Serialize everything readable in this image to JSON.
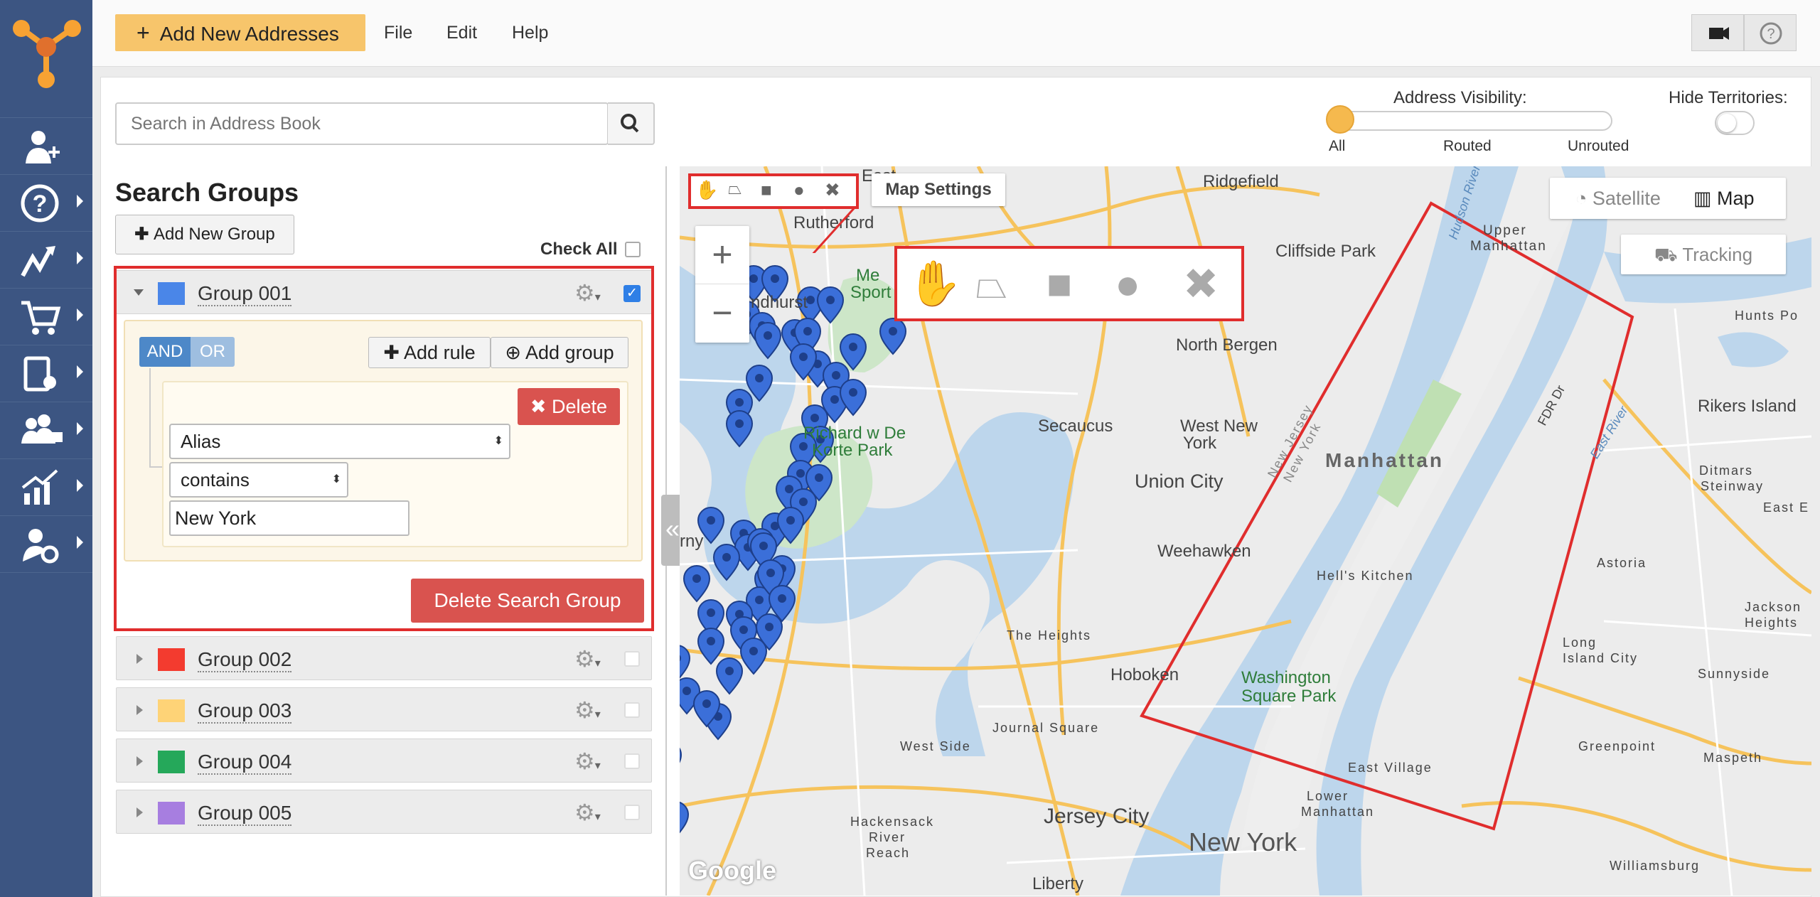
{
  "topbar": {
    "add_label": "Add New Addresses",
    "menu": [
      "File",
      "Edit",
      "Help"
    ]
  },
  "search": {
    "placeholder": "Search in Address Book"
  },
  "visibility": {
    "title": "Address Visibility:",
    "stops": [
      "All",
      "Routed",
      "Unrouted"
    ],
    "selected": "All",
    "hide_territories": "Hide Territories:"
  },
  "groups_panel": {
    "title": "Search Groups",
    "add_group": "Add New Group",
    "check_all": "Check All",
    "groups": [
      {
        "name": "Group 001",
        "color": "#4a86e8",
        "expanded": true,
        "checked": true
      },
      {
        "name": "Group 002",
        "color": "#f33b2f",
        "checked": false
      },
      {
        "name": "Group 003",
        "color": "#fed377",
        "checked": false
      },
      {
        "name": "Group 004",
        "color": "#25a85a",
        "checked": false
      },
      {
        "name": "Group 005",
        "color": "#a77ee0",
        "checked": false
      }
    ],
    "rule": {
      "and": "AND",
      "or": "OR",
      "add_rule": "Add rule",
      "add_group": "Add group",
      "delete": "Delete",
      "field": "Alias",
      "operator": "contains",
      "value": "New York"
    },
    "delete_group": "Delete Search Group"
  },
  "map": {
    "settings": "Map Settings",
    "type_options": [
      "Satellite",
      "Map"
    ],
    "tracking": "Tracking",
    "zoom_in": "+",
    "zoom_out": "−",
    "tools": [
      "hand-tool",
      "polygon-tool",
      "rectangle-tool",
      "circle-tool",
      "clear-tool"
    ],
    "attribution": "Google",
    "labels": [
      "Ridgefield",
      "East",
      "Rutherford",
      "Cliffside Park",
      "Upper",
      "Manhattan",
      "Hunts Po",
      "North Bergen",
      "Secaucus",
      "West New",
      "York",
      "Rikers Island",
      "Union City",
      "Richard w De",
      "Korte Park",
      "Manhattan",
      "Weehawken",
      "Ditmars",
      "Steinway",
      "East E",
      "Astoria",
      "Hell's Kitchen",
      "The Heights",
      "Hoboken",
      "Washington",
      "Square Park",
      "Jackson",
      "Heights",
      "Sunnyside",
      "Long",
      "Island City",
      "Greenpoint",
      "Maspeth",
      "Jersey City",
      "New York",
      "Liberty",
      "Williamsburg",
      "Hackensack",
      "River",
      "Reach",
      "Journal Square",
      "West Side",
      "East Village",
      "Lower",
      "Manhattan",
      "FDR Dr",
      "East River",
      "Hudson River",
      "New Jersey",
      "New York",
      "Me",
      "Sport",
      "ndhurst",
      "rny",
      "Upper",
      "Hackensack",
      "Ridge"
    ]
  },
  "colors": {
    "nav_bg": "#3c5582",
    "accent": "#f7c56b",
    "danger": "#d9534f",
    "highlight": "#e02d2d",
    "pin": "#3b6fd9"
  }
}
